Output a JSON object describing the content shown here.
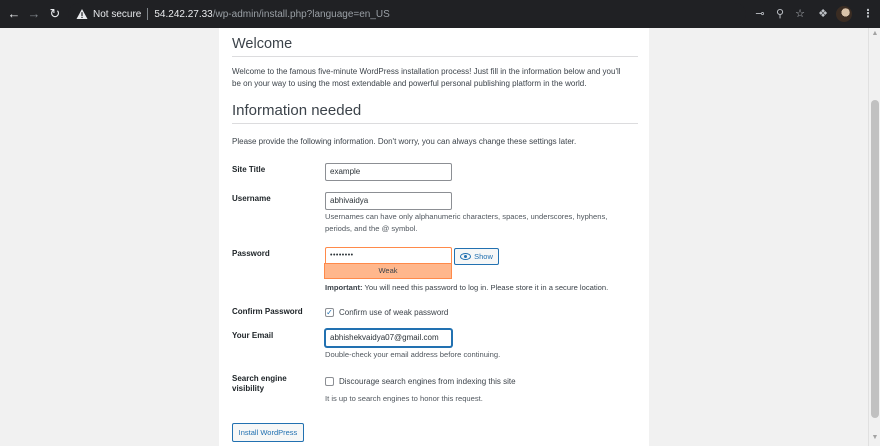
{
  "browser": {
    "security_label": "Not secure",
    "url_host": "54.242.27.33",
    "url_path": "/wp-admin/install.php?language=en_US"
  },
  "welcome": {
    "heading": "Welcome",
    "intro_line1": "Welcome to the famous five-minute WordPress installation process! Just fill in the information below and you'll",
    "intro_line2": "be on your way to using the most extendable and powerful personal publishing platform in the world."
  },
  "info": {
    "heading": "Information needed",
    "description": "Please provide the following information. Don't worry, you can always change these settings later."
  },
  "form": {
    "site_title": {
      "label": "Site Title",
      "value": "example"
    },
    "username": {
      "label": "Username",
      "value": "abhivaidya",
      "help_line1": "Usernames can have only alphanumeric characters, spaces, underscores, hyphens,",
      "help_line2": "periods, and the @ symbol."
    },
    "password": {
      "label": "Password",
      "value": "••••••••",
      "strength": "Weak",
      "show_label": "Show",
      "important_bold": "Important:",
      "important_text": " You will need this password to log in. Please store it in a secure location."
    },
    "confirm_password": {
      "label": "Confirm Password",
      "checkbox_label": "Confirm use of weak password",
      "checked": true
    },
    "email": {
      "label": "Your Email",
      "value": "abhishekvaidya07@gmail.com",
      "help": "Double-check your email address before continuing."
    },
    "search_visibility": {
      "label_line1": "Search engine",
      "label_line2": "visibility",
      "checkbox_label": "Discourage search engines from indexing this site",
      "checked": false,
      "help": "It is up to search engines to honor this request."
    },
    "submit_label": "Install WordPress"
  },
  "colors": {
    "accent": "#2271b1",
    "strength_weak": "#ffb78c",
    "chrome_bg": "#202124"
  }
}
